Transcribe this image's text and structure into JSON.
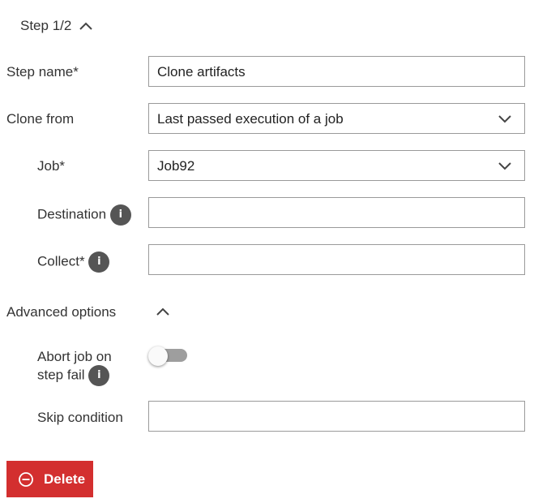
{
  "step": {
    "title": "Step 1/2",
    "toggle_icon": "chevron-up-icon"
  },
  "form": {
    "step_name": {
      "label": "Step name*",
      "value": "Clone artifacts"
    },
    "clone_from": {
      "label": "Clone from",
      "value": "Last passed execution of a job",
      "icon": "chevron-down-icon"
    },
    "job": {
      "label": "Job*",
      "value": "Job92",
      "icon": "chevron-down-icon"
    },
    "destination": {
      "label": "Destination",
      "value": "",
      "info_icon": "i"
    },
    "collect": {
      "label": "Collect*",
      "value": "",
      "info_icon": "i"
    }
  },
  "advanced": {
    "title": "Advanced options",
    "toggle_icon": "chevron-up-icon",
    "abort": {
      "label_line1": "Abort job on",
      "label_line2": "step fail",
      "info_icon": "i",
      "enabled": false
    },
    "skip_condition": {
      "label": "Skip condition",
      "value": ""
    }
  },
  "actions": {
    "delete_label": "Delete",
    "delete_icon": "minus-circle-icon",
    "delete_color": "#d32f2f"
  }
}
